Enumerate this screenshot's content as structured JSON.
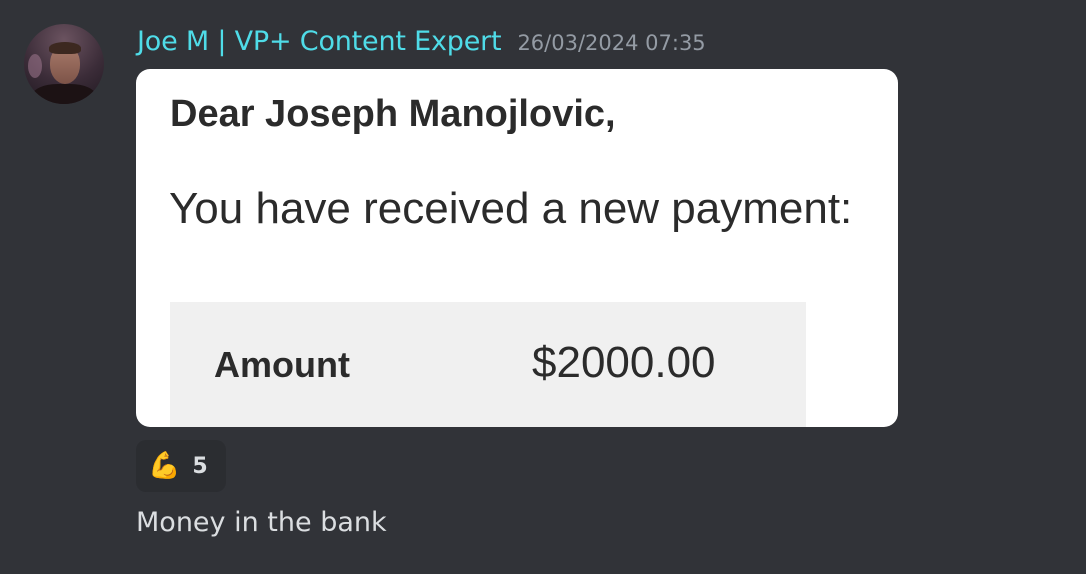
{
  "message": {
    "author": {
      "name": "Joe M  | VP+ Content Expert",
      "avatar_alt": "Joe M avatar"
    },
    "timestamp": "26/03/2024 07:35",
    "embed": {
      "greeting": "Dear Joseph Manojlovic,",
      "payment_line": "You have received a new payment:",
      "amount_label": "Amount",
      "amount_value": "$2000.00"
    },
    "reaction": {
      "emoji": "💪",
      "emoji_name": "flexed-biceps-icon",
      "count": "5"
    },
    "text": "Money in the bank"
  },
  "colors": {
    "background": "#313338",
    "username": "#4fdce8",
    "timestamp": "#949ba4",
    "text": "#dbdee1",
    "reaction_bg": "#2b2d31"
  }
}
